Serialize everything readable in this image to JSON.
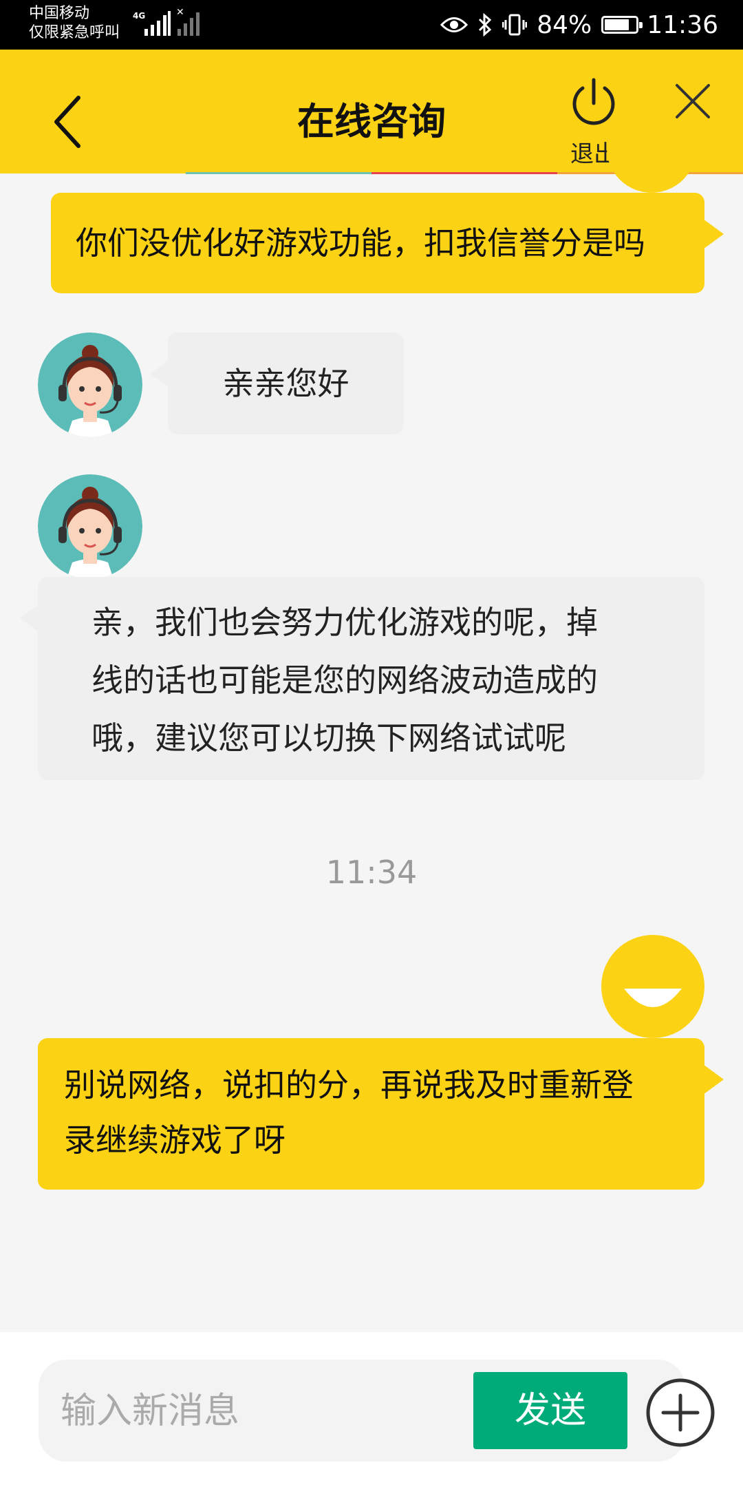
{
  "status_bar": {
    "carrier_line1": "中国移动",
    "carrier_line2": "仅限紧急呼叫",
    "network_type": "4G",
    "battery_percent": "84%",
    "battery_level": 0.84,
    "time": "11:36",
    "icons": [
      "eye-icon",
      "bluetooth-icon",
      "vibrate-icon",
      "battery-icon"
    ]
  },
  "header": {
    "title": "在线咨询",
    "exit_label": "退出",
    "back_icon": "chevron-left-icon",
    "exit_icon": "power-icon",
    "close_icon": "close-icon",
    "background_color": "#fcd214"
  },
  "messages": [
    {
      "sender": "user",
      "text": "你们没优化好游戏功能，扣我信誉分是吗"
    },
    {
      "sender": "agent",
      "text": "亲亲您好"
    },
    {
      "sender": "agent",
      "text": "亲，我们也会努力优化游戏的呢，掉线的话也可能是您的网络波动造成的哦，建议您可以切换下网络试试呢"
    },
    {
      "sender": "time",
      "text": "11:34"
    },
    {
      "sender": "user",
      "text": "别说网络，说扣的分，再说我及时重新登录继续游戏了呀"
    }
  ],
  "input": {
    "placeholder": "输入新消息",
    "value": "",
    "send_label": "发送",
    "add_icon": "plus-circle-icon",
    "send_color": "#00ab7a"
  }
}
